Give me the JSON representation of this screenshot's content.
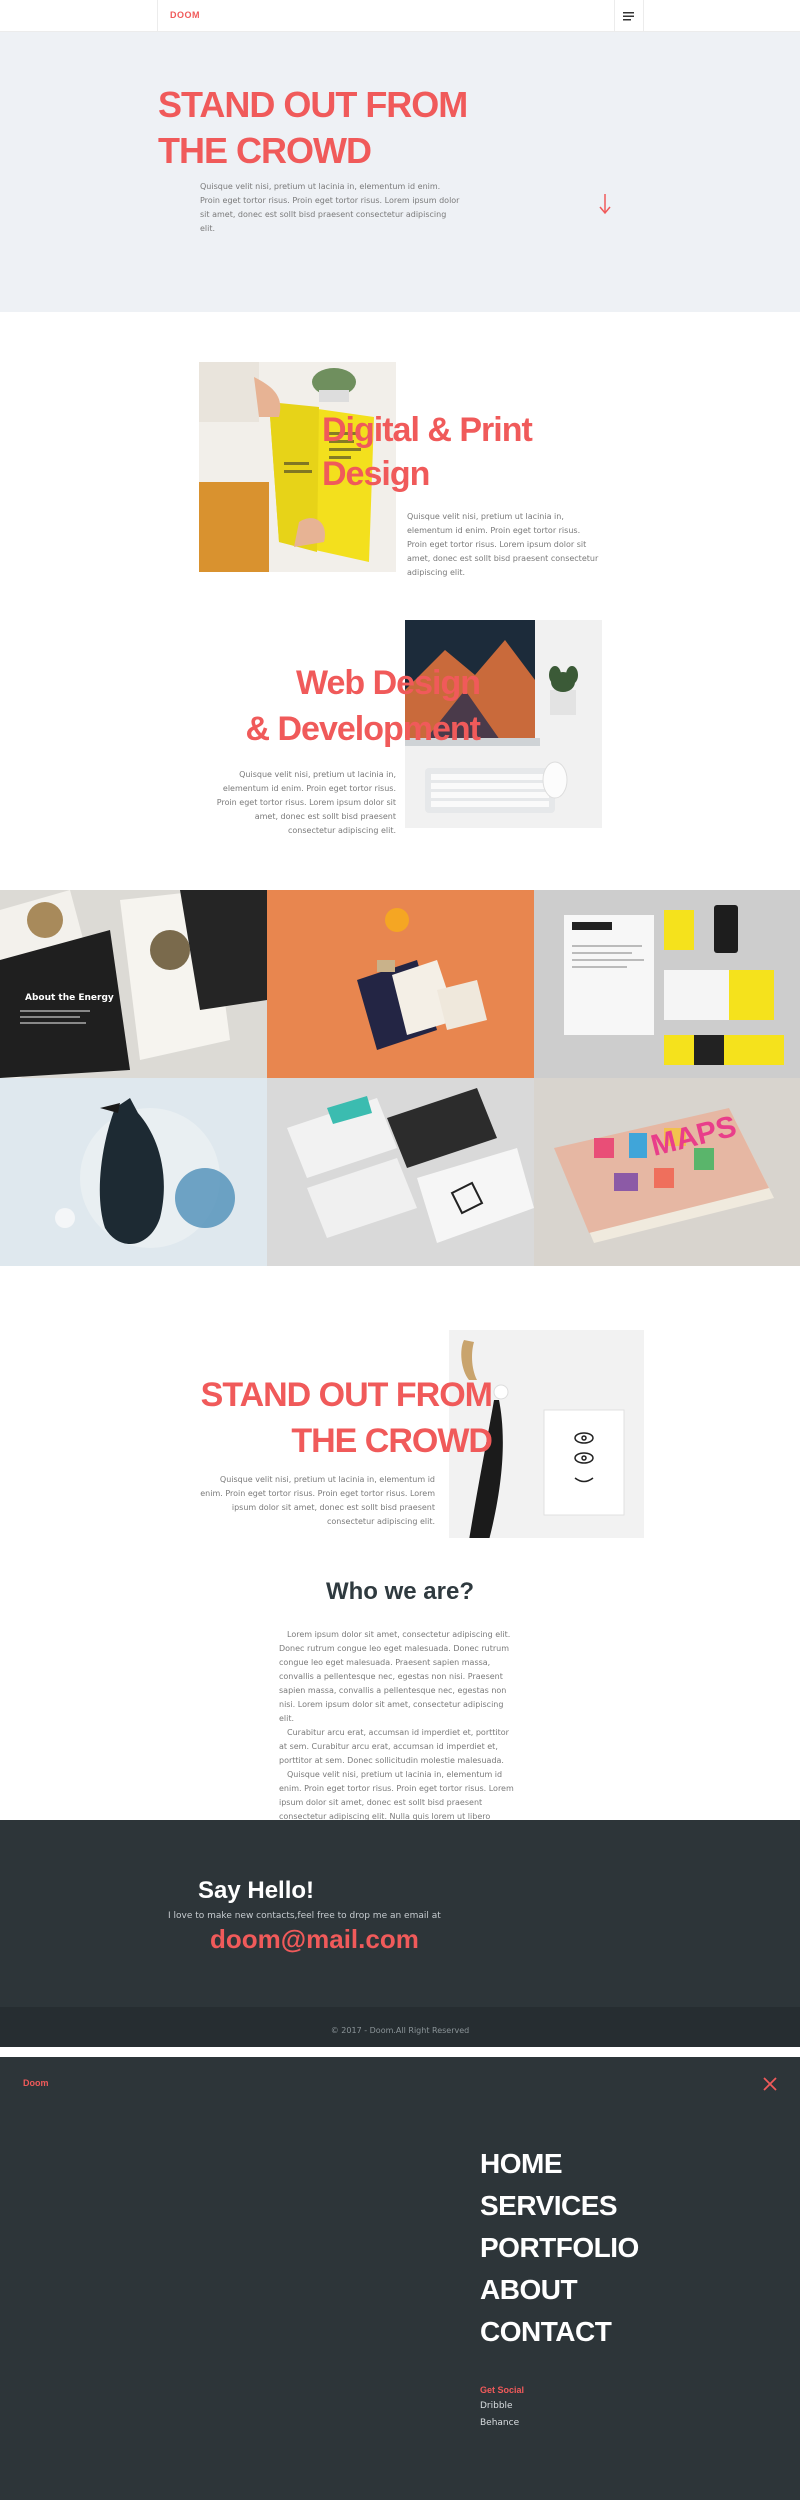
{
  "nav": {
    "brand": "DOOM"
  },
  "hero": {
    "title_line1": "STAND OUT FROM",
    "title_line2": "THE CROWD",
    "text": "Quisque velit nisi, pretium ut lacinia in, elementum id enim. Proin eget tortor risus. Proin eget tortor risus. Lorem ipsum dolor sit amet, donec est sollt bisd praesent consectetur adipiscing elit."
  },
  "services": [
    {
      "title_line1": "Digital & Print",
      "title_line2": "Design",
      "text": "Quisque velit nisi, pretium ut lacinia in, elementum id enim. Proin eget tortor risus. Proin eget tortor risus. Lorem ipsum dolor sit amet, donec est sollt bisd praesent consectetur adipiscing elit."
    },
    {
      "title_line1": "Web Design",
      "title_line2": "& Development",
      "text": "Quisque velit nisi, pretium ut lacinia in, elementum id enim. Proin eget tortor risus. Proin eget tortor risus. Lorem ipsum dolor sit amet, donec est sollt bisd praesent consectetur adipiscing elit."
    }
  ],
  "portfolio": {
    "tiles": [
      {
        "name": "poster-cards"
      },
      {
        "name": "stationery-orange"
      },
      {
        "name": "energy-branding"
      },
      {
        "name": "raven-art"
      },
      {
        "name": "business-cards"
      },
      {
        "name": "maps-books"
      }
    ]
  },
  "standout2": {
    "title_line1": "STAND OUT FROM",
    "title_line2": "THE CROWD",
    "text": "Quisque velit nisi, pretium ut lacinia in, elementum id enim. Proin eget tortor risus. Proin eget tortor risus. Lorem ipsum dolor sit amet, donec est sollt bisd praesent consectetur adipiscing elit."
  },
  "who": {
    "title": "Who we are?",
    "p1": "Lorem ipsum dolor sit amet, consectetur adipiscing elit. Donec rutrum congue leo eget malesuada. Donec rutrum congue leo eget malesuada. Praesent sapien massa, convallis a pellentesque nec, egestas non nisi. Praesent sapien massa, convallis a pellentesque nec, egestas non nisi. Lorem ipsum dolor sit amet, consectetur adipiscing elit.",
    "p2": "Curabitur arcu erat, accumsan id imperdiet et, porttitor at sem. Curabitur arcu erat, accumsan id imperdiet et, porttitor at sem. Donec sollicitudin molestie malesuada.",
    "p3": "Quisque velit nisi, pretium ut lacinia in, elementum id enim. Proin eget tortor risus. Proin eget tortor risus. Lorem ipsum dolor sit amet, donec est sollt bisd praesent consectetur adipiscing elit. Nulla quis lorem ut libero malesuada feugiat. Curabitur arcu erat, accumsan id imperdiet et, porttitor at sem. Vivamus suscipit tortor eget felis porttitor volutpat."
  },
  "contact": {
    "title": "Say Hello!",
    "subtitle": "I love to make new contacts,feel free to drop me an email at",
    "email": "doom@mail.com"
  },
  "footer": {
    "text": "© 2017 - Doom.All Right Reserved"
  },
  "overlay": {
    "brand": "Doom",
    "menu": [
      "HOME",
      "SERVICES",
      "PORTFOLIO",
      "ABOUT",
      "CONTACT"
    ],
    "social_heading": "Get Social",
    "social": [
      "Dribble",
      "Behance"
    ]
  },
  "colors": {
    "accent": "#f05a5a",
    "dark": "#2d3539",
    "hero_bg": "#eef1f5"
  }
}
